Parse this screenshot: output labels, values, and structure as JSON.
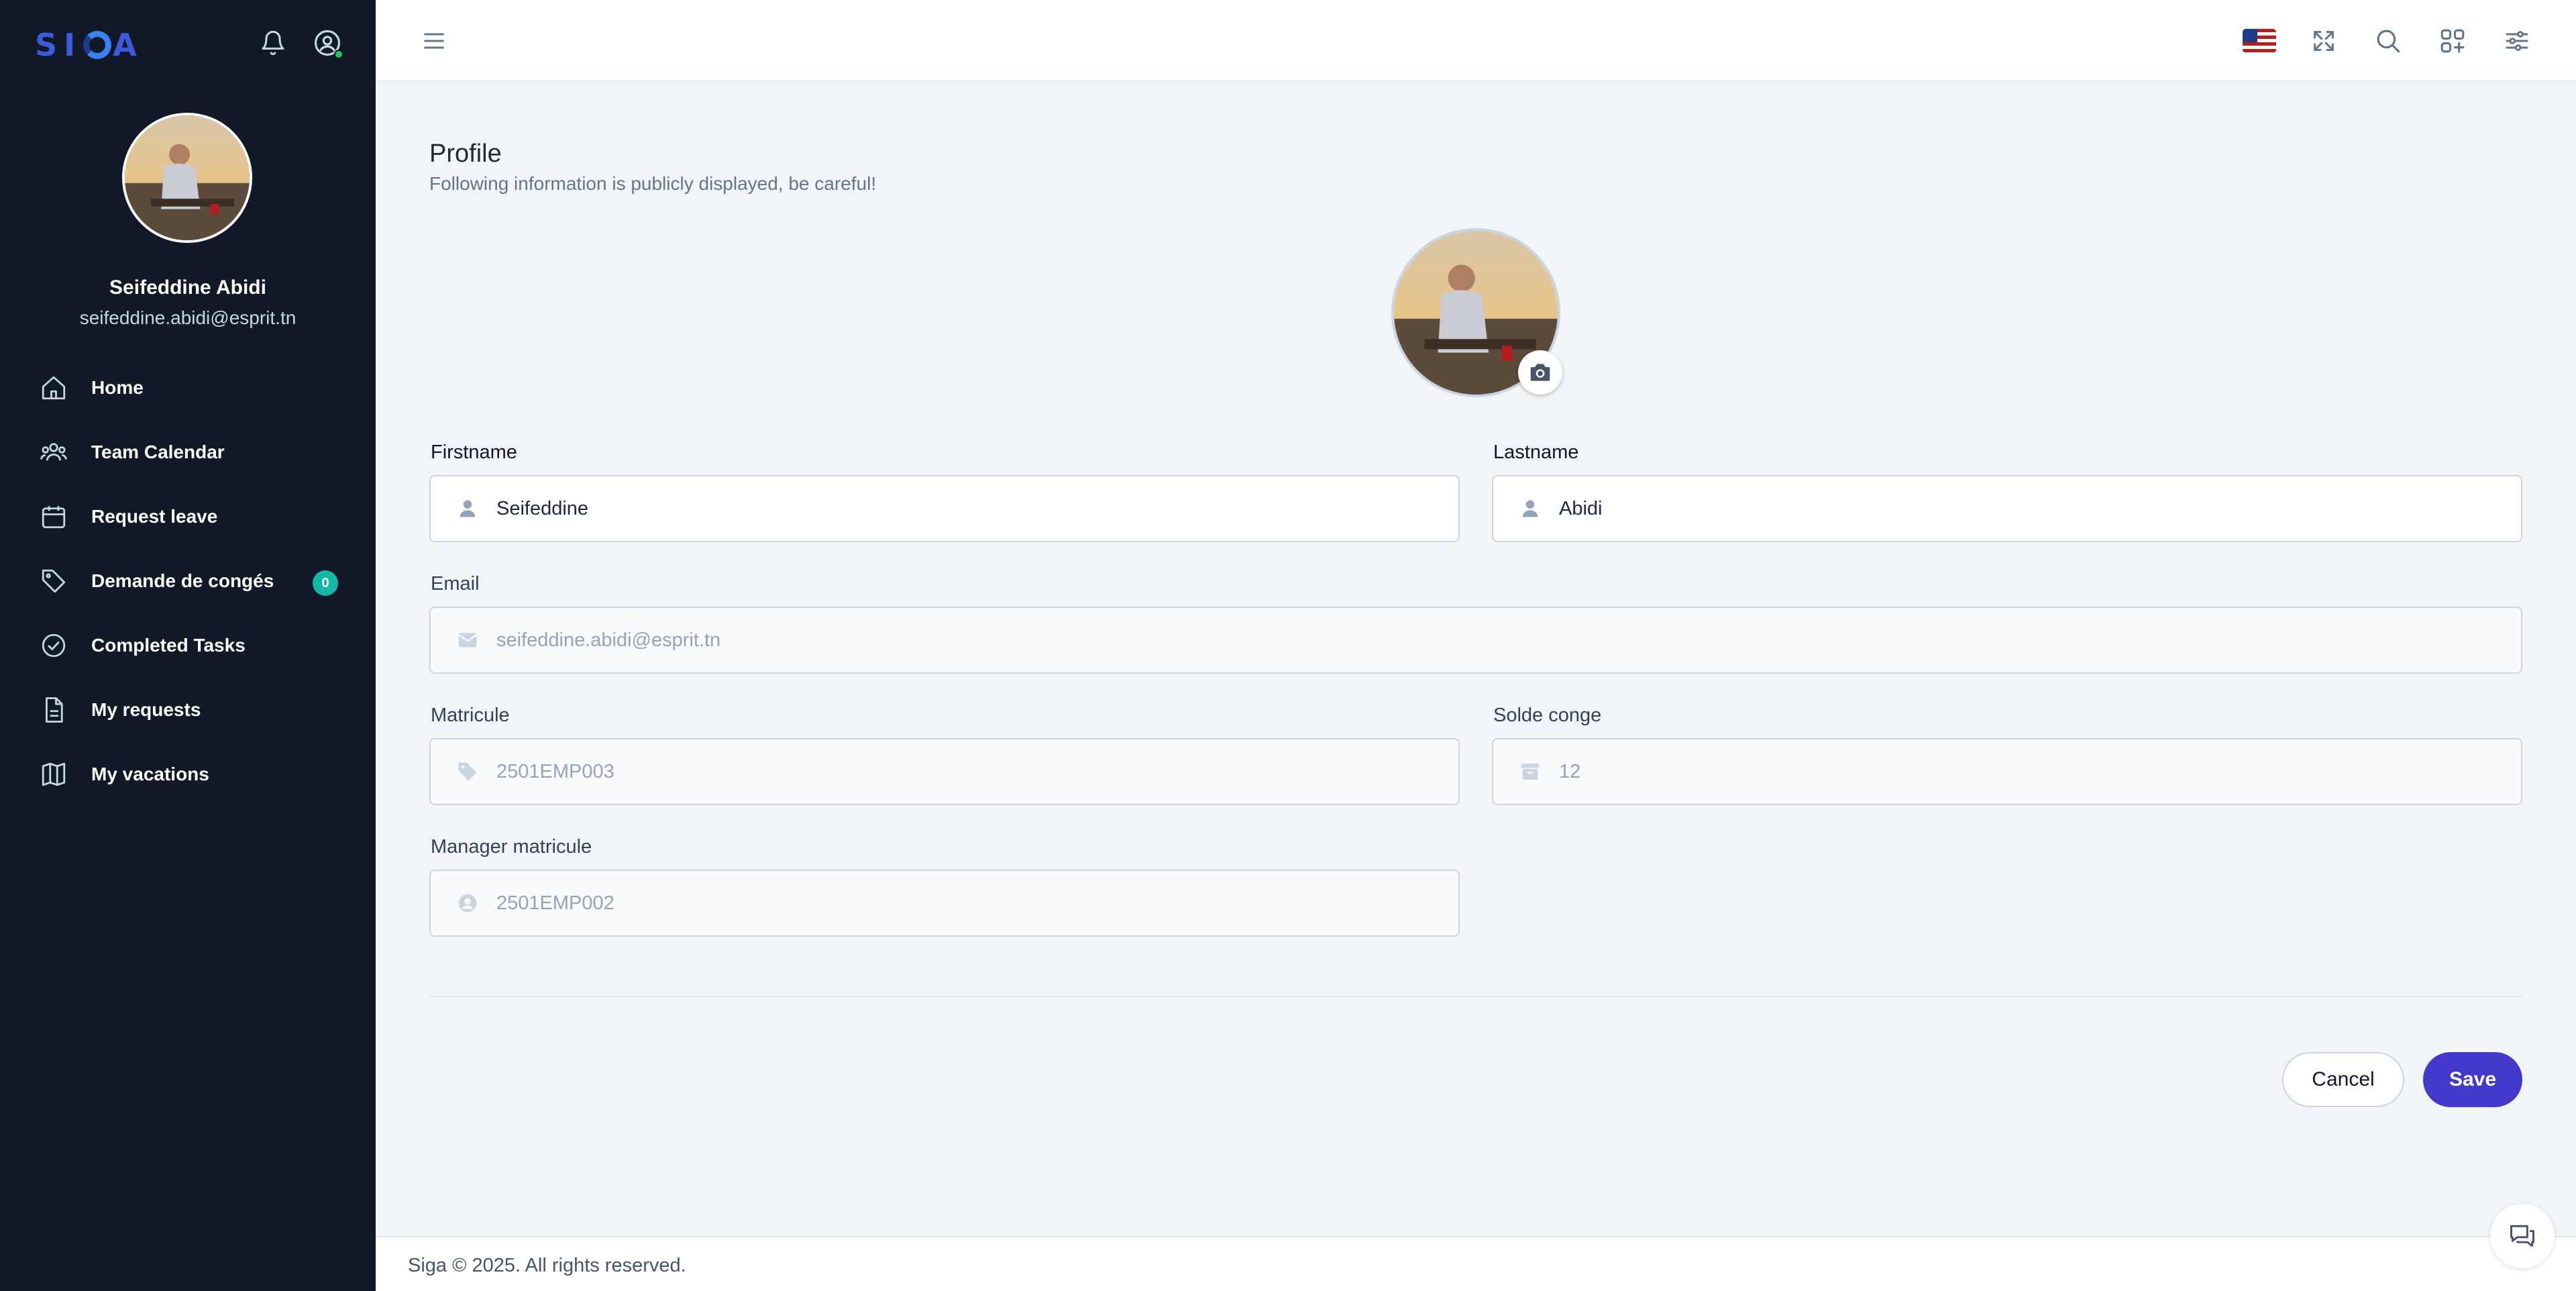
{
  "brand": {
    "logo_text_left": "SI",
    "logo_text_right": "A"
  },
  "sidebar": {
    "user_name": "Seifeddine Abidi",
    "user_email": "seifeddine.abidi@esprit.tn",
    "items": [
      {
        "label": "Home",
        "icon": "home-icon"
      },
      {
        "label": "Team Calendar",
        "icon": "team-icon"
      },
      {
        "label": "Request leave",
        "icon": "calendar-icon"
      },
      {
        "label": "Demande de congés",
        "icon": "tag-icon",
        "badge": "0"
      },
      {
        "label": "Completed Tasks",
        "icon": "check-circle-icon"
      },
      {
        "label": "My requests",
        "icon": "document-icon"
      },
      {
        "label": "My vacations",
        "icon": "map-icon"
      }
    ]
  },
  "page": {
    "title": "Profile",
    "subtitle": "Following information is publicly displayed, be careful!"
  },
  "form": {
    "firstname": {
      "label": "Firstname",
      "value": "Seifeddine"
    },
    "lastname": {
      "label": "Lastname",
      "value": "Abidi"
    },
    "email": {
      "label": "Email",
      "value": "seifeddine.abidi@esprit.tn"
    },
    "matricule": {
      "label": "Matricule",
      "value": "2501EMP003"
    },
    "solde_conge": {
      "label": "Solde conge",
      "value": "12"
    },
    "manager_matricule": {
      "label": "Manager matricule",
      "value": "2501EMP002"
    }
  },
  "actions": {
    "cancel_label": "Cancel",
    "save_label": "Save"
  },
  "footer": {
    "text": "Siga © 2025. All rights reserved."
  },
  "colors": {
    "sidebar_bg": "#111827",
    "accent": "#4338ca",
    "badge": "#14b8a6",
    "online": "#22c55e"
  }
}
